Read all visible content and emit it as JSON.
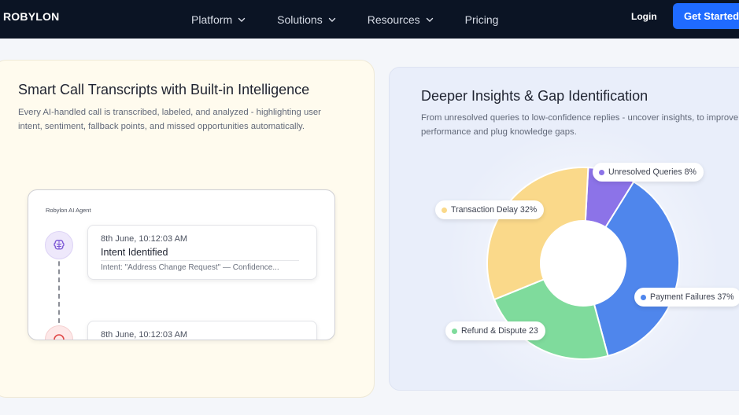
{
  "nav": {
    "logo": "ROBYLON",
    "links": [
      {
        "label": "Platform",
        "has_dropdown": true
      },
      {
        "label": "Solutions",
        "has_dropdown": true
      },
      {
        "label": "Resources",
        "has_dropdown": true
      },
      {
        "label": "Pricing",
        "has_dropdown": false
      }
    ],
    "login": "Login",
    "cta": "Get Started"
  },
  "left_card": {
    "title": "Smart Call Transcripts with Built-in Intelligence",
    "description": "Every AI-handled call is transcribed, labeled, and analyzed - highlighting user intent, sentiment, fallback points, and missed opportunities automatically.",
    "agent_label": "Robylon AI Agent",
    "events": [
      {
        "time": "8th June, 10:12:03 AM",
        "title": "Intent Identified",
        "detail": "Intent: \"Address Change Request\" — Confidence...",
        "icon": "brain-icon"
      },
      {
        "time": "8th June, 10:12:03 AM",
        "title": "",
        "detail": "",
        "icon": "alert-icon"
      }
    ]
  },
  "right_card": {
    "title": "Deeper Insights & Gap Identification",
    "description": "From unresolved queries to low-confidence replies - uncover insights, to improve performance and plug knowledge gaps."
  },
  "chart_data": {
    "type": "pie",
    "donut": true,
    "title": "",
    "categories": [
      "Unresolved Queries",
      "Payment Failures",
      "Refund & Dispute",
      "Transaction Delay"
    ],
    "values": [
      8,
      37,
      23,
      32
    ],
    "labels": [
      "Unresolved Queries 8%",
      "Payment Failures 37%",
      "Refund & Dispute 23",
      "Transaction Delay 32%"
    ],
    "colors": [
      "#8c73e8",
      "#4f86ec",
      "#7fdb9c",
      "#fad98a"
    ],
    "legend": "callout-labels"
  },
  "colors": {
    "nav_bg": "#0b1424",
    "cta_bg": "#1f6bff",
    "left_card_bg": "#fffbee",
    "right_card_bg": "#e9eefa"
  }
}
